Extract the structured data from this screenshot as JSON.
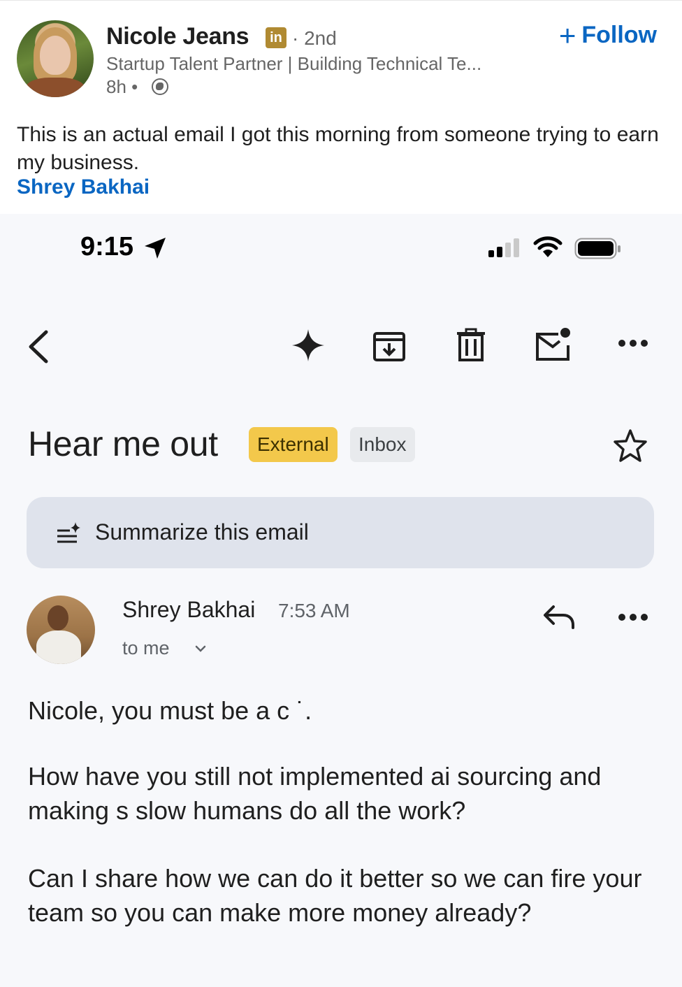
{
  "post": {
    "author_name": "Nicole Jeans",
    "badge": "in",
    "degree": "· 2nd",
    "headline": "Startup Talent Partner | Building Technical Te...",
    "time": "8h •",
    "follow_label": "Follow",
    "text": "This is an actual email I got this morning from someone trying to earn my business.",
    "mention": "Shrey Bakhai",
    "icons": [
      "linkedin-badge-icon",
      "globe-icon",
      "plus-icon"
    ]
  },
  "phone": {
    "status_time": "9:15",
    "icons": [
      "location-arrow-icon",
      "signal-icon",
      "wifi-icon",
      "battery-icon"
    ]
  },
  "toolbar": {
    "icons": [
      "back-icon",
      "sparkle-icon",
      "archive-icon",
      "trash-icon",
      "mark-unread-icon",
      "more-icon"
    ]
  },
  "email": {
    "subject": "Hear me out",
    "labels": [
      "External",
      "Inbox"
    ],
    "summarize_label": "Summarize this email",
    "sender": "Shrey Bakhai",
    "time": "7:53 AM",
    "recipient": "to me",
    "body": [
      "Nicole, you must be a c     ˙.",
      "How have you still not implemented ai sourcing and making s           slow humans do all the work?",
      "Can I share how we can do it better so we can fire your team so you can make more money already?"
    ]
  },
  "colors": {
    "linkedin_blue": "#0a66c2",
    "external_label": "#f3c84b",
    "inbox_label": "#e8eaed",
    "summarize_bg": "#dfe3ec"
  }
}
